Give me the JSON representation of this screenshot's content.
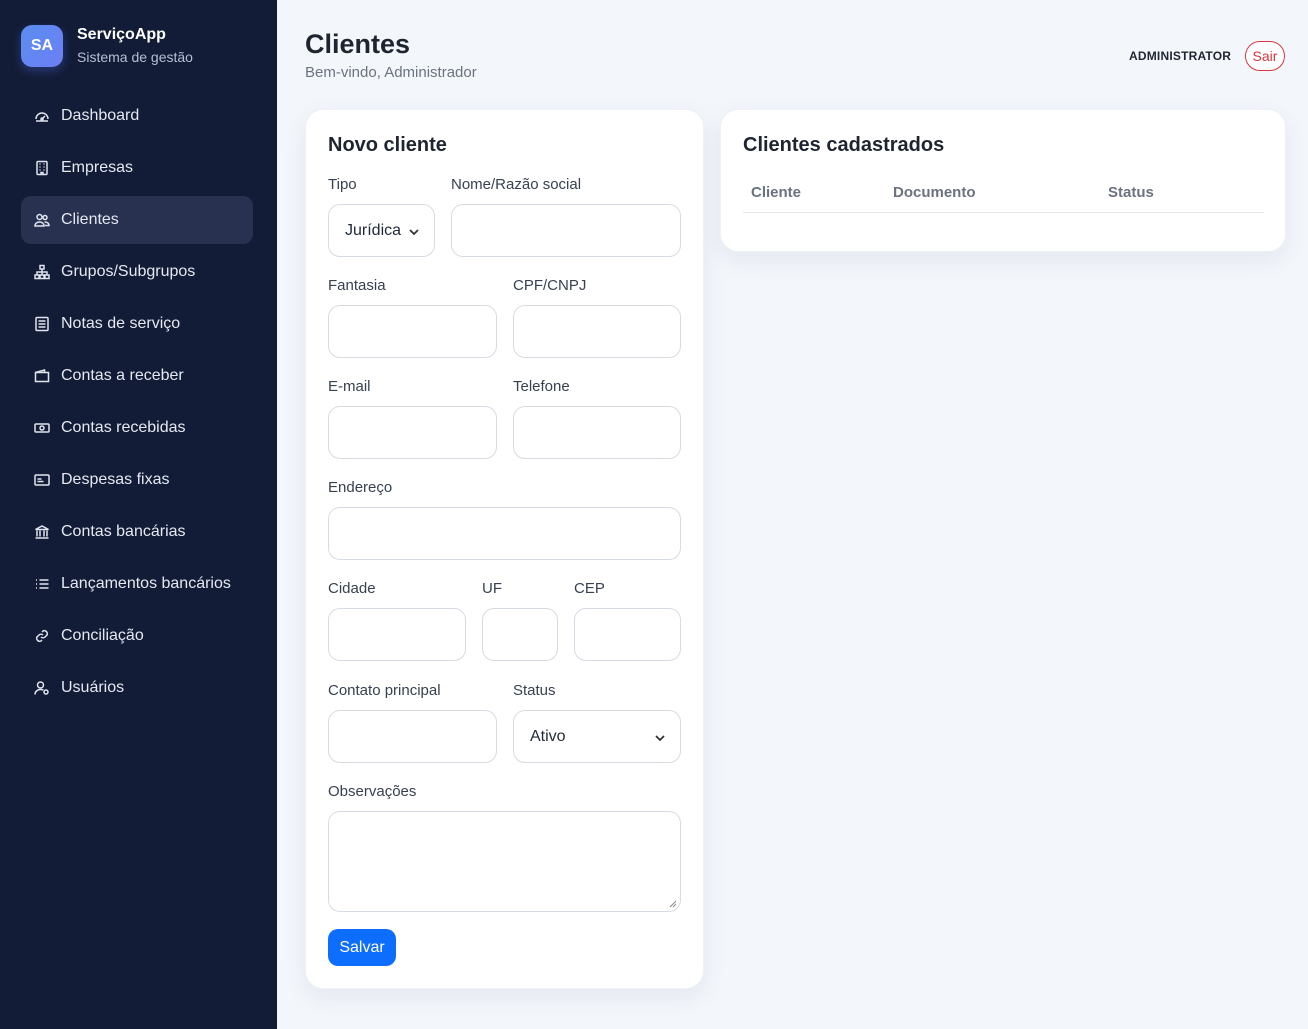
{
  "brand": {
    "logo": "SA",
    "name": "ServiçoApp",
    "subtitle": "Sistema de gestão"
  },
  "nav": [
    {
      "label": "Dashboard",
      "icon": "gauge-icon",
      "active": false
    },
    {
      "label": "Empresas",
      "icon": "building-icon",
      "active": false
    },
    {
      "label": "Clientes",
      "icon": "people-icon",
      "active": true
    },
    {
      "label": "Grupos/Subgrupos",
      "icon": "diagram-icon",
      "active": false
    },
    {
      "label": "Notas de serviço",
      "icon": "document-icon",
      "active": false
    },
    {
      "label": "Contas a receber",
      "icon": "wallet-icon",
      "active": false
    },
    {
      "label": "Contas recebidas",
      "icon": "cash-icon",
      "active": false
    },
    {
      "label": "Despesas fixas",
      "icon": "card-icon",
      "active": false
    },
    {
      "label": "Contas bancárias",
      "icon": "bank-icon",
      "active": false
    },
    {
      "label": "Lançamentos bancários",
      "icon": "list-icon",
      "active": false
    },
    {
      "label": "Conciliação",
      "icon": "link-icon",
      "active": false
    },
    {
      "label": "Usuários",
      "icon": "user-gear-icon",
      "active": false
    }
  ],
  "header": {
    "title": "Clientes",
    "subtitle": "Bem-vindo, Administrador",
    "user": "ADMINISTRATOR",
    "logout": "Sair"
  },
  "form": {
    "title": "Novo cliente",
    "tipo_label": "Tipo",
    "tipo_value": "Jurídica",
    "nome_label": "Nome/Razão social",
    "nome_value": "",
    "fantasia_label": "Fantasia",
    "fantasia_value": "",
    "cpf_label": "CPF/CNPJ",
    "cpf_value": "",
    "email_label": "E-mail",
    "email_value": "",
    "telefone_label": "Telefone",
    "telefone_value": "",
    "endereco_label": "Endereço",
    "endereco_value": "",
    "cidade_label": "Cidade",
    "cidade_value": "",
    "uf_label": "UF",
    "uf_value": "",
    "cep_label": "CEP",
    "cep_value": "",
    "contato_label": "Contato principal",
    "contato_value": "",
    "status_label": "Status",
    "status_value": "Ativo",
    "obs_label": "Observações",
    "obs_value": "",
    "save": "Salvar"
  },
  "list": {
    "title": "Clientes cadastrados",
    "columns": [
      "Cliente",
      "Documento",
      "Status"
    ],
    "rows": []
  },
  "colors": {
    "sidebar": "#131c36",
    "active_item": "#283250",
    "primary": "#0d6efd",
    "danger": "#d9383f"
  }
}
